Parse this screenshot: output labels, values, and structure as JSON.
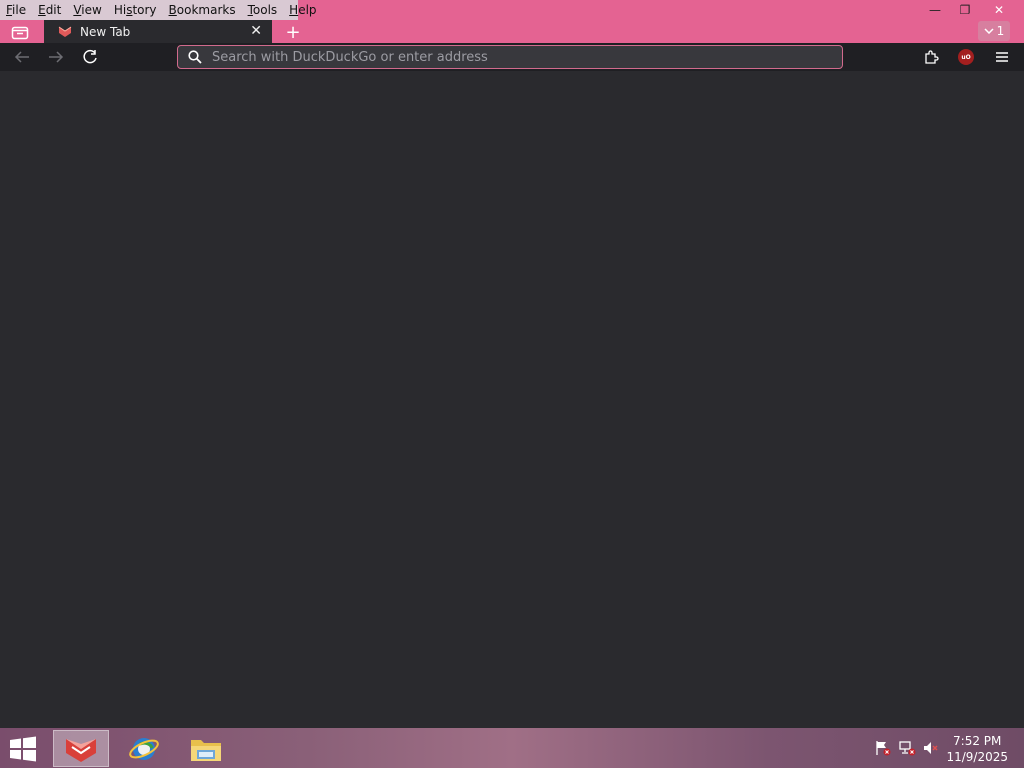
{
  "menu": {
    "items": [
      {
        "label": "File",
        "u": "F",
        "rest": "ile"
      },
      {
        "label": "Edit",
        "u": "E",
        "rest": "dit"
      },
      {
        "label": "View",
        "u": "V",
        "rest": "iew"
      },
      {
        "label": "History",
        "pre": "Hi",
        "u": "s",
        "rest": "tory"
      },
      {
        "label": "Bookmarks",
        "u": "B",
        "rest": "ookmarks"
      },
      {
        "label": "Tools",
        "u": "T",
        "rest": "ools"
      },
      {
        "label": "Help",
        "u": "H",
        "rest": "elp"
      }
    ]
  },
  "tab": {
    "title": "New Tab",
    "close_glyph": "✕"
  },
  "new_tab_glyph": "+",
  "tab_list": {
    "count": "1"
  },
  "url_bar": {
    "placeholder": "Search with DuckDuckGo or enter address",
    "value": ""
  },
  "ublock_label": "uO",
  "window_controls": {
    "minimize": "—",
    "restore": "❐",
    "close": "✕"
  },
  "clock": {
    "time": "7:52 PM",
    "date": "11/9/2025"
  },
  "colors": {
    "accent": "#e46392",
    "toolbar": "#1f1f23",
    "content": "#2a2a2e"
  },
  "icons": {
    "tab_overview": "tab-overview-icon",
    "back": "back-arrow-icon",
    "forward": "forward-arrow-icon",
    "reload": "reload-icon",
    "search": "search-icon",
    "extensions": "extensions-puzzle-icon",
    "menu": "hamburger-menu-icon"
  }
}
